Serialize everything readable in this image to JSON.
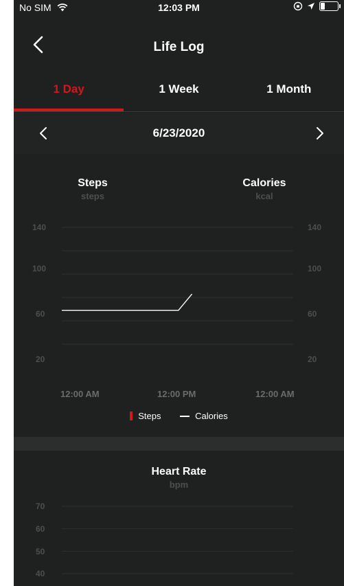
{
  "status_bar": {
    "carrier": "No SIM",
    "time": "12:03 PM"
  },
  "nav": {
    "title": "Life Log"
  },
  "tabs": [
    {
      "label": "1 Day",
      "active": true
    },
    {
      "label": "1 Week",
      "active": false
    },
    {
      "label": "1 Month",
      "active": false
    }
  ],
  "date_bar": {
    "date": "6/23/2020"
  },
  "steps_calories": {
    "left_title": "Steps",
    "left_unit": "steps",
    "right_title": "Calories",
    "right_unit": "kcal",
    "y_ticks": [
      "140",
      "100",
      "60",
      "20"
    ],
    "x_ticks": [
      "12:00 AM",
      "12:00 PM",
      "12:00 AM"
    ],
    "legend": {
      "steps": "Steps",
      "calories": "Calories"
    }
  },
  "heart_rate": {
    "title": "Heart Rate",
    "unit": "bpm",
    "y_ticks": [
      "70",
      "60",
      "50",
      "40"
    ]
  },
  "colors": {
    "accent": "#d4161d",
    "background": "#1f2121"
  },
  "chart_data": [
    {
      "type": "line",
      "x": [
        "12:00 AM",
        "12:00 PM",
        "12:00 AM"
      ],
      "ylim": [
        0,
        150
      ],
      "series": [
        {
          "name": "Steps",
          "values": []
        },
        {
          "name": "Calories",
          "values": [
            [
              0,
              69
            ],
            [
              12.1,
              69
            ],
            [
              13.5,
              83
            ]
          ]
        }
      ]
    },
    {
      "type": "line",
      "title": "Heart Rate",
      "ylim": [
        35,
        75
      ],
      "series": []
    }
  ]
}
